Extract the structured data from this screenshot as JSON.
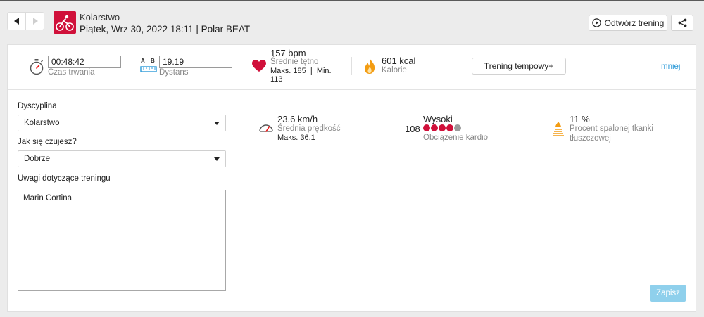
{
  "header": {
    "title": "Kolarstwo",
    "subtitle": "Piątek, Wrz 30, 2022 18:11 | Polar BEAT",
    "replay_label": "Odtwórz trening"
  },
  "summary": {
    "duration_value": "00:48:42",
    "duration_label": "Czas trwania",
    "distance_ab_a": "A",
    "distance_ab_b": "B",
    "distance_value": "19.19",
    "distance_label": "Dystans",
    "hr_value": "157 bpm",
    "hr_label": "Średnie tętno",
    "hr_max_min": "Maks. 185  |  Min.",
    "hr_min_value": "113",
    "calories_value": "601 kcal",
    "calories_label": "Kalorie",
    "tempo_button": "Trening tempowy+",
    "less_link": "mniej"
  },
  "form": {
    "discipline_label": "Dyscyplina",
    "discipline_value": "Kolarstwo",
    "feeling_label": "Jak się czujesz?",
    "feeling_value": "Dobrze",
    "notes_label": "Uwagi dotyczące treningu",
    "notes_value": "Marin Cortina"
  },
  "stats": {
    "speed_value": "23.6 km/h",
    "speed_label": "Średnia prędkość",
    "speed_max": "Maks. 36.1",
    "cardio_level": "Wysoki",
    "cardio_number": "108",
    "cardio_dots_filled": 4,
    "cardio_dots_total": 5,
    "cardio_label": "Obciążenie kardio",
    "fat_value": "11 %",
    "fat_label_line1": "Procent spalonej tkanki",
    "fat_label_line2": "tłuszczowej"
  },
  "save_label": "Zapisz",
  "colors": {
    "brand_red": "#d0103a",
    "link_blue": "#2c9ad8",
    "save_blue": "#8fd0ec",
    "fire_orange": "#f39c12",
    "dot_grey": "#9a9a9a"
  }
}
